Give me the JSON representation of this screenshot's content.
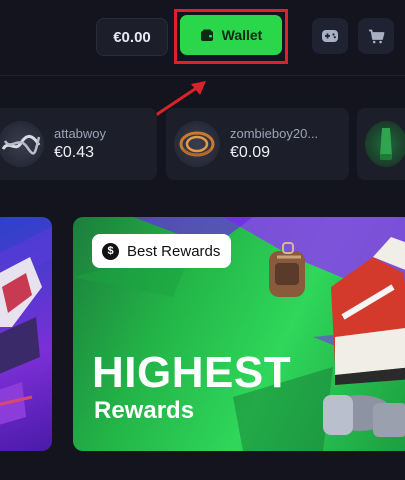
{
  "header": {
    "balance": "€0.00",
    "wallet_label": "Wallet",
    "icons": [
      "gamepad-icon",
      "cart-icon"
    ]
  },
  "recent_drops": [
    {
      "user": "",
      "price": "",
      "item_color": "#38c060"
    },
    {
      "user": "attabwoy",
      "price": "€0.43",
      "item_color": "#d8dbe4"
    },
    {
      "user": "zombieboy20...",
      "price": "€0.09",
      "item_color": "#c97a2e"
    },
    {
      "user": "",
      "price": "",
      "item_color": "#2fa54f"
    }
  ],
  "promo": {
    "badge_label": "Best Rewards",
    "headline": "HIGHEST",
    "subline": "Rewards"
  },
  "colors": {
    "accent_green": "#2ad64a",
    "highlight_red": "#e0202a",
    "background": "#13141d",
    "card": "#1c1e2a"
  }
}
